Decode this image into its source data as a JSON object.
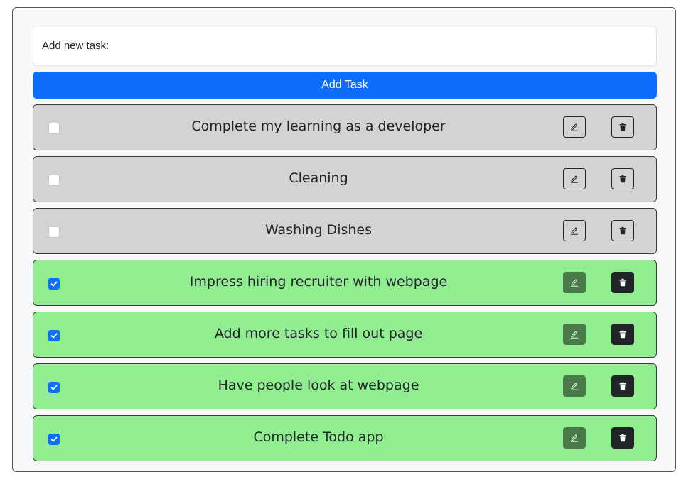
{
  "new_task": {
    "placeholder": "Add new task:",
    "value": ""
  },
  "add_button": {
    "label": "Add Task"
  },
  "colors": {
    "accent": "#0d6efd",
    "pending_row": "#d3d3d3",
    "completed_row": "#90ee90",
    "edit_button_completed": "#4a7a4a",
    "delete_button_completed": "#212529"
  },
  "tasks": [
    {
      "text": "Complete my learning as a developer",
      "completed": false,
      "edit_icon": "pencil-icon",
      "delete_icon": "trash-icon"
    },
    {
      "text": "Cleaning",
      "completed": false,
      "edit_icon": "pencil-icon",
      "delete_icon": "trash-icon"
    },
    {
      "text": "Washing Dishes",
      "completed": false,
      "edit_icon": "pencil-icon",
      "delete_icon": "trash-icon"
    },
    {
      "text": "Impress hiring recruiter with webpage",
      "completed": true,
      "edit_icon": "pencil-icon",
      "delete_icon": "trash-icon"
    },
    {
      "text": "Add more tasks to fill out page",
      "completed": true,
      "edit_icon": "pencil-icon",
      "delete_icon": "trash-icon"
    },
    {
      "text": "Have people look at webpage",
      "completed": true,
      "edit_icon": "pencil-icon",
      "delete_icon": "trash-icon"
    },
    {
      "text": "Complete Todo app",
      "completed": true,
      "edit_icon": "pencil-icon",
      "delete_icon": "trash-icon"
    }
  ]
}
